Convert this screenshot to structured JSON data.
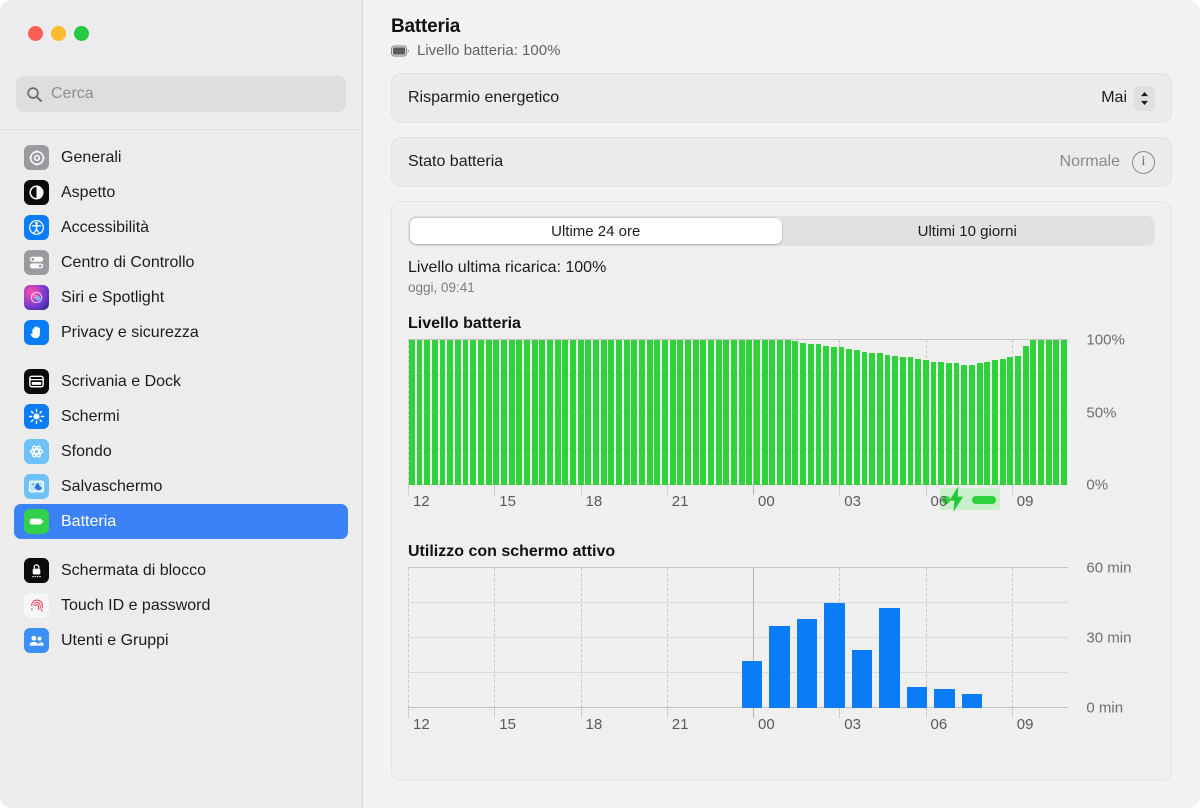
{
  "window": {
    "traffic_lights": [
      "close",
      "minimize",
      "zoom"
    ],
    "colors": {
      "close": "#fc5f57",
      "minimize": "#fdbc2e",
      "zoom": "#28c840",
      "accent": "#3b82f7",
      "battery_green": "#30d23c",
      "usage_blue": "#0a7cf8"
    }
  },
  "search": {
    "placeholder": "Cerca",
    "value": "",
    "icon": "search-icon"
  },
  "sidebar": {
    "groups": [
      {
        "items": [
          {
            "label": "Generali",
            "icon": "gear-icon",
            "selected": false
          },
          {
            "label": "Aspetto",
            "icon": "appearance-icon",
            "selected": false
          },
          {
            "label": "Accessibilità",
            "icon": "accessibility-icon",
            "selected": false
          },
          {
            "label": "Centro di Controllo",
            "icon": "control-center-icon",
            "selected": false
          },
          {
            "label": "Siri e Spotlight",
            "icon": "siri-icon",
            "selected": false
          },
          {
            "label": "Privacy e sicurezza",
            "icon": "privacy-hand-icon",
            "selected": false
          }
        ]
      },
      {
        "items": [
          {
            "label": "Scrivania e Dock",
            "icon": "desktop-dock-icon",
            "selected": false
          },
          {
            "label": "Schermi",
            "icon": "display-brightness-icon",
            "selected": false
          },
          {
            "label": "Sfondo",
            "icon": "wallpaper-icon",
            "selected": false
          },
          {
            "label": "Salvaschermo",
            "icon": "screensaver-icon",
            "selected": false
          },
          {
            "label": "Batteria",
            "icon": "battery-icon",
            "selected": true
          }
        ]
      },
      {
        "items": [
          {
            "label": "Schermata di blocco",
            "icon": "lock-screen-icon",
            "selected": false
          },
          {
            "label": "Touch ID e password",
            "icon": "touch-id-icon",
            "selected": false
          },
          {
            "label": "Utenti e Gruppi",
            "icon": "users-groups-icon",
            "selected": false
          }
        ]
      }
    ]
  },
  "main": {
    "title": "Batteria",
    "subtitle": "Livello batteria: 100%",
    "subtitle_icon": "battery-full-icon",
    "rows": [
      {
        "label": "Risparmio energetico",
        "value": "Mai",
        "control": "popup-button"
      },
      {
        "label": "Stato batteria",
        "value": "Normale",
        "control": "info-button"
      }
    ],
    "tabs": [
      {
        "label": "Ultime 24 ore",
        "active": true
      },
      {
        "label": "Ultimi 10 giorni",
        "active": false
      }
    ],
    "last_charge_title": "Livello ultima ricarica: 100%",
    "last_charge_sub": "oggi, 09:41"
  },
  "chart_data": [
    {
      "type": "bar",
      "title": "Livello batteria",
      "xlabel": "",
      "ylabel": "",
      "ylim": [
        0,
        100
      ],
      "ytick_labels": [
        "0%",
        "50%",
        "100%"
      ],
      "ytick_values": [
        0,
        50,
        100
      ],
      "gridlines_y": [
        0,
        25,
        50,
        75,
        100
      ],
      "grid": true,
      "xtick_labels": [
        "12",
        "15",
        "18",
        "21",
        "00",
        "03",
        "06",
        "09"
      ],
      "series_color": "#30d23c",
      "charging_periods": [
        {
          "start_hour": 6.5,
          "end_hour": 8.6,
          "label": "charging"
        }
      ],
      "x": [
        12.0,
        12.25,
        12.5,
        12.75,
        13.0,
        13.25,
        13.5,
        13.75,
        14.0,
        14.25,
        14.5,
        14.75,
        15.0,
        15.25,
        15.5,
        15.75,
        16.0,
        16.25,
        16.5,
        16.75,
        17.0,
        17.25,
        17.5,
        17.75,
        18.0,
        18.25,
        18.5,
        18.75,
        19.0,
        19.25,
        19.5,
        19.75,
        20.0,
        20.25,
        20.5,
        20.75,
        21.0,
        21.25,
        21.5,
        21.75,
        22.0,
        22.25,
        22.5,
        22.75,
        23.0,
        23.25,
        23.5,
        23.75,
        0.0,
        0.25,
        0.5,
        0.75,
        1.0,
        1.25,
        1.5,
        1.75,
        2.0,
        2.25,
        2.5,
        2.75,
        3.0,
        3.25,
        3.5,
        3.75,
        4.0,
        4.25,
        4.5,
        4.75,
        5.0,
        5.25,
        5.5,
        5.75,
        6.0,
        6.25,
        6.5,
        6.75,
        7.0,
        7.25,
        7.5,
        7.75,
        8.0,
        8.25,
        8.5,
        8.75,
        9.0,
        9.25
      ],
      "values": [
        100,
        100,
        100,
        100,
        100,
        100,
        100,
        100,
        100,
        100,
        100,
        100,
        100,
        100,
        100,
        100,
        100,
        100,
        100,
        100,
        100,
        100,
        100,
        100,
        100,
        100,
        100,
        100,
        100,
        100,
        100,
        100,
        100,
        100,
        100,
        100,
        100,
        100,
        100,
        100,
        100,
        100,
        100,
        100,
        100,
        100,
        100,
        100,
        100,
        100,
        99,
        98,
        97,
        97,
        96,
        95,
        95,
        94,
        93,
        92,
        91,
        91,
        90,
        89,
        88,
        88,
        87,
        86,
        85,
        85,
        84,
        84,
        83,
        83,
        84,
        85,
        86,
        87,
        88,
        89,
        96,
        100,
        100,
        100,
        100,
        100
      ]
    },
    {
      "type": "bar",
      "title": "Utilizzo con schermo attivo",
      "xlabel": "",
      "ylabel": "min",
      "ylim": [
        0,
        60
      ],
      "ytick_labels": [
        "0 min",
        "30 min",
        "60 min"
      ],
      "ytick_values": [
        0,
        30,
        60
      ],
      "gridlines_y": [
        0,
        15,
        30,
        45,
        60
      ],
      "grid": true,
      "xtick_labels": [
        "12",
        "15",
        "18",
        "21",
        "00",
        "03",
        "06",
        "09"
      ],
      "series_color": "#0a7cf8",
      "categories": [
        "12",
        "13",
        "14",
        "15",
        "16",
        "17",
        "18",
        "19",
        "20",
        "21",
        "22",
        "23",
        "00",
        "01",
        "02",
        "03",
        "04",
        "05",
        "06",
        "07",
        "08",
        "09",
        "10",
        "11"
      ],
      "values": [
        0,
        0,
        0,
        0,
        0,
        0,
        0,
        0,
        0,
        0,
        0,
        0,
        20,
        35,
        38,
        45,
        25,
        43,
        9,
        8,
        6,
        0,
        0,
        0
      ]
    }
  ]
}
